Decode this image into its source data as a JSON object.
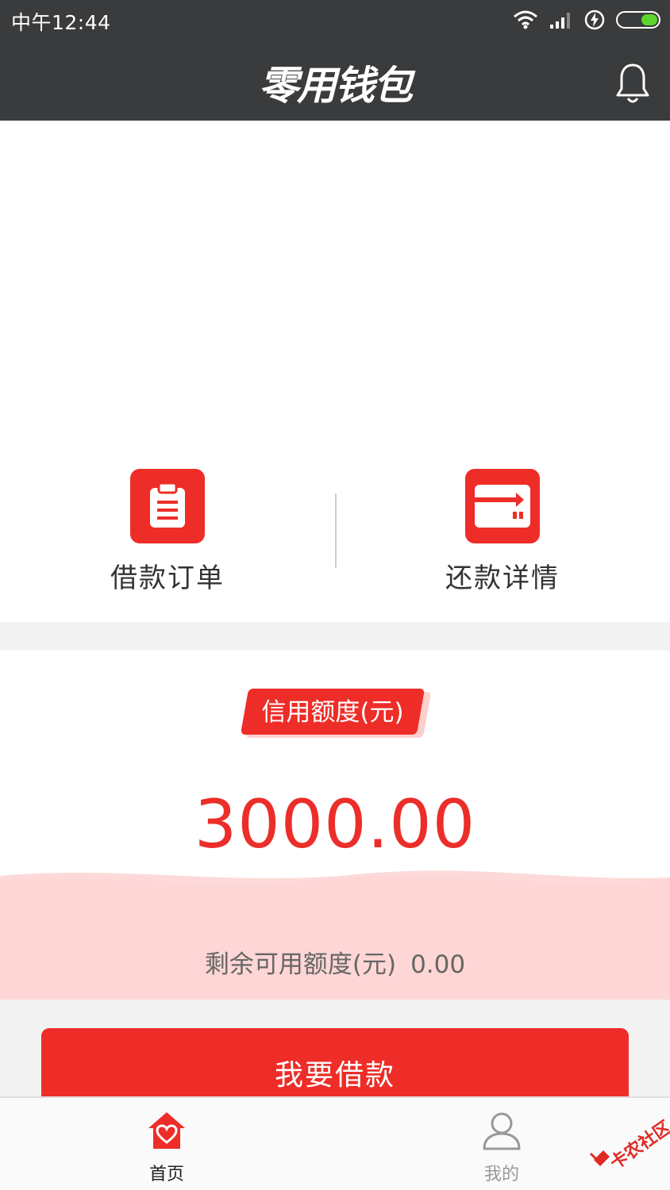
{
  "status_bar": {
    "time": "中午12:44"
  },
  "header": {
    "title": "零用钱包"
  },
  "shortcuts": [
    {
      "label": "借款订单",
      "icon": "clipboard-icon"
    },
    {
      "label": "还款详情",
      "icon": "card-icon"
    }
  ],
  "credit": {
    "tag_label": "信用额度(元)",
    "amount": "3000.00",
    "remaining_label": "剩余可用额度(元)",
    "remaining_value": "0.00"
  },
  "action": {
    "borrow_label": "我要借款"
  },
  "tabs": [
    {
      "label": "首页",
      "icon": "home-heart-icon",
      "active": true
    },
    {
      "label": "我的",
      "icon": "user-icon",
      "active": false
    }
  ],
  "watermark": {
    "text": "卡农社区"
  },
  "colors": {
    "header_bg": "#3a3b3c",
    "accent": "#ee2d28",
    "wave": "#fdd3d2",
    "battery": "#5ed52e"
  }
}
